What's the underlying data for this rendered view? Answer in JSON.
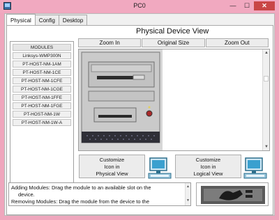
{
  "window": {
    "title": "PC0",
    "minimize": "—",
    "maximize": "☐",
    "close": "✕"
  },
  "tabs": [
    {
      "label": "Physical",
      "active": true
    },
    {
      "label": "Config",
      "active": false
    },
    {
      "label": "Desktop",
      "active": false
    }
  ],
  "modules": {
    "header": "MODULES",
    "items": [
      "Linksys-WMP300N",
      "PT-HOST-NM-1AM",
      "PT-HOST-NM-1CE",
      "PT-HOST-NM-1CFE",
      "PT-HOST-NM-1CGE",
      "PT-HOST-NM-1FFE",
      "PT-HOST-NM-1FGE",
      "PT-HOST-NM-1W",
      "PT-HOST-NM-1W-A"
    ]
  },
  "physical_view": {
    "title": "Physical Device View",
    "zoom_in": "Zoom In",
    "original_size": "Original Size",
    "zoom_out": "Zoom Out"
  },
  "customize": {
    "physical": [
      "Customize",
      "Icon in",
      "Physical View"
    ],
    "logical": [
      "Customize",
      "Icon in",
      "Logical View"
    ]
  },
  "status": {
    "line1": "Adding Modules: Drag the module to an available slot on the",
    "line2": "device.",
    "line3": "Removing Modules: Drag the module from the device to the"
  },
  "colors": {
    "titlebar": "#f1a9c0",
    "close": "#c94646",
    "device_body": "#c9c9c9",
    "led": "#aa2a2a"
  }
}
